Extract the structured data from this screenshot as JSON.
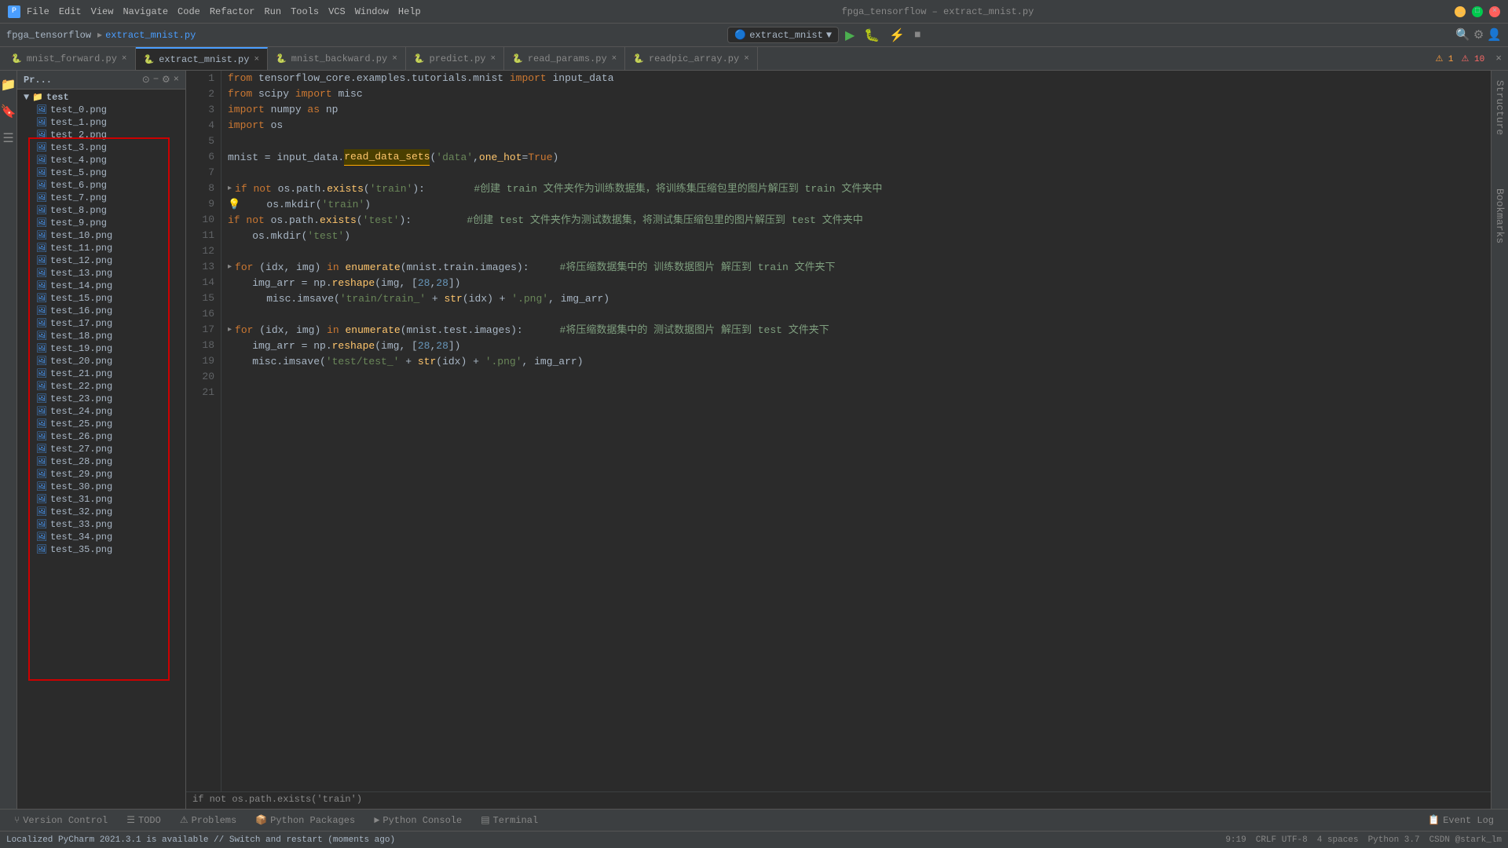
{
  "titlebar": {
    "app_name": "fpga_tensorflow",
    "file_name": "extract_mnist.py",
    "title": "fpga_tensorflow – extract_mnist.py",
    "menu": [
      "File",
      "Edit",
      "View",
      "Navigate",
      "Code",
      "Refactor",
      "Run",
      "Tools",
      "VCS",
      "Window",
      "Help"
    ]
  },
  "run_config": {
    "label": "extract_mnist",
    "icon": "▶"
  },
  "editor_tabs": [
    {
      "label": "mnist_forward.py",
      "active": false,
      "modified": false
    },
    {
      "label": "extract_mnist.py",
      "active": true,
      "modified": false
    },
    {
      "label": "mnist_backward.py",
      "active": false,
      "modified": false
    },
    {
      "label": "predict.py",
      "active": false,
      "modified": false
    },
    {
      "label": "read_params.py",
      "active": false,
      "modified": false
    },
    {
      "label": "readpic_array.py",
      "active": false,
      "modified": false
    }
  ],
  "project_panel": {
    "title": "Pr...",
    "folder": "test",
    "files": [
      "test_0.png",
      "test_1.png",
      "test_2.png",
      "test_3.png",
      "test_4.png",
      "test_5.png",
      "test_6.png",
      "test_7.png",
      "test_8.png",
      "test_9.png",
      "test_10.png",
      "test_11.png",
      "test_12.png",
      "test_13.png",
      "test_14.png",
      "test_15.png",
      "test_16.png",
      "test_17.png",
      "test_18.png",
      "test_19.png",
      "test_20.png",
      "test_21.png",
      "test_22.png",
      "test_23.png",
      "test_24.png",
      "test_25.png",
      "test_26.png",
      "test_27.png",
      "test_28.png",
      "test_29.png",
      "test_30.png",
      "test_31.png",
      "test_32.png",
      "test_33.png",
      "test_34.png",
      "test_35.png"
    ]
  },
  "code_lines": [
    {
      "num": 1,
      "text": "from tensorflow_core.examples.tutorials.mnist import input_data"
    },
    {
      "num": 2,
      "text": "from scipy import misc"
    },
    {
      "num": 3,
      "text": "import numpy as np"
    },
    {
      "num": 4,
      "text": "import os"
    },
    {
      "num": 5,
      "text": ""
    },
    {
      "num": 6,
      "text": "mnist = input_data.read_data_sets('data', one_hot=True)"
    },
    {
      "num": 7,
      "text": ""
    },
    {
      "num": 8,
      "text": "if not os.path.exists('train'):        #创建 train 文件夹作为训练数据集，将训练集压缩包里的图片解压到 train 文件夹中"
    },
    {
      "num": 9,
      "text": "    os.mkdir('train')"
    },
    {
      "num": 10,
      "text": "if not os.path.exists('test'):         #创建 test 文件夹作为测试数据集，将测试集压缩包里的图片解压到 test 文件夹中"
    },
    {
      "num": 11,
      "text": "    os.mkdir('test')"
    },
    {
      "num": 12,
      "text": ""
    },
    {
      "num": 13,
      "text": "for (idx, img) in enumerate(mnist.train.images):     #将压缩数据集中的 训练数据图片 解压到 train 文件夹下"
    },
    {
      "num": 14,
      "text": "    img_arr = np.reshape(img, [28,28])"
    },
    {
      "num": 15,
      "text": "    misc.imsave('train/train_' + str(idx) + '.png', img_arr)"
    },
    {
      "num": 16,
      "text": ""
    },
    {
      "num": 17,
      "text": "for (idx, img) in enumerate(mnist.test.images):      #将压缩数据集中的 测试数据图片 解压到 test 文件夹下"
    },
    {
      "num": 18,
      "text": "    img_arr = np.reshape(img, [28,28])"
    },
    {
      "num": 19,
      "text": "    misc.imsave('test/test_' + str(idx) + '.png', img_arr)"
    },
    {
      "num": 20,
      "text": ""
    },
    {
      "num": 21,
      "text": ""
    }
  ],
  "bottom_tabs": [
    {
      "label": "Version Control",
      "icon": "⑂"
    },
    {
      "label": "TODO",
      "icon": "☰"
    },
    {
      "label": "Problems",
      "icon": "⚠"
    },
    {
      "label": "Python Packages",
      "icon": "📦"
    },
    {
      "label": "Python Console",
      "icon": "►"
    },
    {
      "label": "Terminal",
      "icon": "▤"
    }
  ],
  "event_log": "Event Log",
  "status": {
    "notification": "Localized PyCharm 2021.3.1 is available // Switch and restart (moments ago)",
    "line_col": "9:19",
    "encoding": "CRLF  UTF-8",
    "indent": "4 spaces",
    "python": "Python 3.7",
    "branch": "CSDN @stark_lm",
    "warnings": "1",
    "errors": "10"
  },
  "bottom_hint": "if not os.path.exists('train')"
}
